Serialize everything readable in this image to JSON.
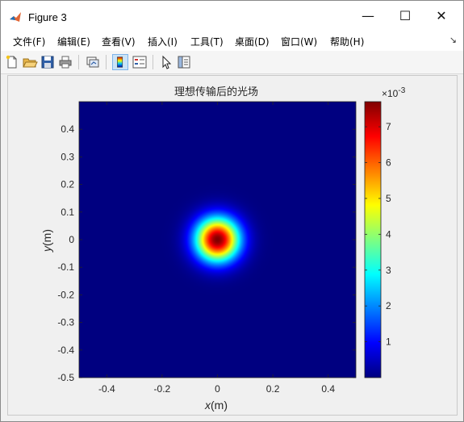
{
  "window": {
    "title": "Figure 3",
    "minimize_glyph": "—",
    "maximize_glyph": "☐",
    "close_glyph": "✕"
  },
  "menu": {
    "items": [
      "文件(F)",
      "编辑(E)",
      "查看(V)",
      "插入(I)",
      "工具(T)",
      "桌面(D)",
      "窗口(W)",
      "帮助(H)"
    ],
    "dock_glyph": "↘"
  },
  "toolbar": {
    "icons": [
      "new-figure-icon",
      "open-file-icon",
      "save-icon",
      "print-icon",
      "link-plot-icon",
      "colorbar-icon",
      "legend-icon",
      "pointer-icon",
      "property-inspector-icon"
    ],
    "active": [
      "colorbar-icon"
    ]
  },
  "colors": {
    "background": "#00008f",
    "peak": "#800000",
    "figure_bg": "#f0f0f0"
  },
  "chart_data": {
    "type": "heatmap",
    "title": "理想传输后的光场",
    "xlabel_italic": "x",
    "xlabel_unit": "(m)",
    "ylabel_italic": "y",
    "ylabel_unit": "(m)",
    "xlim": [
      -0.5,
      0.5
    ],
    "ylim": [
      -0.5,
      0.5
    ],
    "x_ticks": [
      -0.4,
      -0.2,
      0,
      0.2,
      0.4
    ],
    "x_tick_labels": [
      "-0.4",
      "-0.2",
      "0",
      "0.2",
      "0.4"
    ],
    "y_ticks": [
      -0.5,
      -0.4,
      -0.3,
      -0.2,
      -0.1,
      0,
      0.1,
      0.2,
      0.3,
      0.4
    ],
    "y_tick_labels": [
      "-0.5",
      "-0.4",
      "-0.3",
      "-0.2",
      "-0.1",
      "0",
      "0.1",
      "0.2",
      "0.3",
      "0.4"
    ],
    "colormap": "jet",
    "field": {
      "shape": "gaussian",
      "center": [
        0.0,
        0.0
      ],
      "peak_value": 0.0077,
      "min_value": 0.0,
      "sigma": 0.055
    },
    "colorbar": {
      "ticks": [
        1,
        2,
        3,
        4,
        5,
        6,
        7
      ],
      "tick_labels": [
        "1",
        "2",
        "3",
        "4",
        "5",
        "6",
        "7"
      ],
      "range": [
        0,
        7.7
      ],
      "multiplier_base": "×10",
      "multiplier_exp": "-3"
    },
    "grid": false
  }
}
